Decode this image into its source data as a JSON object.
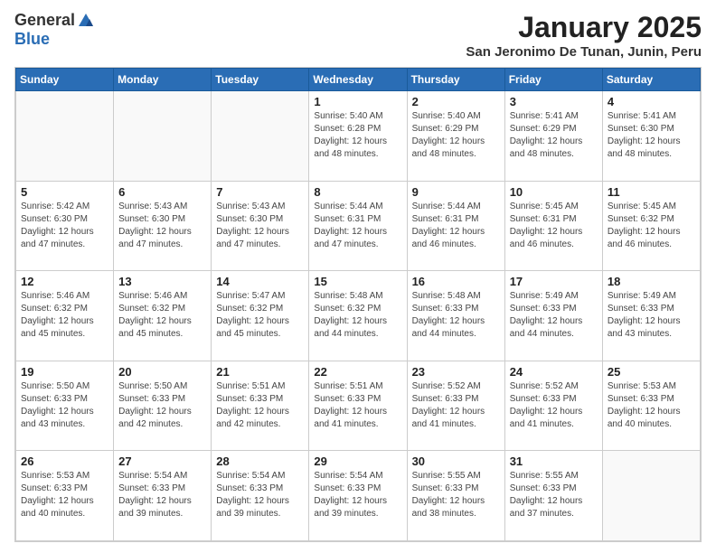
{
  "header": {
    "logo": {
      "general": "General",
      "blue": "Blue"
    },
    "title": "January 2025",
    "subtitle": "San Jeronimo De Tunan, Junin, Peru"
  },
  "calendar": {
    "days_of_week": [
      "Sunday",
      "Monday",
      "Tuesday",
      "Wednesday",
      "Thursday",
      "Friday",
      "Saturday"
    ],
    "weeks": [
      [
        {
          "day": "",
          "info": ""
        },
        {
          "day": "",
          "info": ""
        },
        {
          "day": "",
          "info": ""
        },
        {
          "day": "1",
          "info": "Sunrise: 5:40 AM\nSunset: 6:28 PM\nDaylight: 12 hours\nand 48 minutes."
        },
        {
          "day": "2",
          "info": "Sunrise: 5:40 AM\nSunset: 6:29 PM\nDaylight: 12 hours\nand 48 minutes."
        },
        {
          "day": "3",
          "info": "Sunrise: 5:41 AM\nSunset: 6:29 PM\nDaylight: 12 hours\nand 48 minutes."
        },
        {
          "day": "4",
          "info": "Sunrise: 5:41 AM\nSunset: 6:30 PM\nDaylight: 12 hours\nand 48 minutes."
        }
      ],
      [
        {
          "day": "5",
          "info": "Sunrise: 5:42 AM\nSunset: 6:30 PM\nDaylight: 12 hours\nand 47 minutes."
        },
        {
          "day": "6",
          "info": "Sunrise: 5:43 AM\nSunset: 6:30 PM\nDaylight: 12 hours\nand 47 minutes."
        },
        {
          "day": "7",
          "info": "Sunrise: 5:43 AM\nSunset: 6:30 PM\nDaylight: 12 hours\nand 47 minutes."
        },
        {
          "day": "8",
          "info": "Sunrise: 5:44 AM\nSunset: 6:31 PM\nDaylight: 12 hours\nand 47 minutes."
        },
        {
          "day": "9",
          "info": "Sunrise: 5:44 AM\nSunset: 6:31 PM\nDaylight: 12 hours\nand 46 minutes."
        },
        {
          "day": "10",
          "info": "Sunrise: 5:45 AM\nSunset: 6:31 PM\nDaylight: 12 hours\nand 46 minutes."
        },
        {
          "day": "11",
          "info": "Sunrise: 5:45 AM\nSunset: 6:32 PM\nDaylight: 12 hours\nand 46 minutes."
        }
      ],
      [
        {
          "day": "12",
          "info": "Sunrise: 5:46 AM\nSunset: 6:32 PM\nDaylight: 12 hours\nand 45 minutes."
        },
        {
          "day": "13",
          "info": "Sunrise: 5:46 AM\nSunset: 6:32 PM\nDaylight: 12 hours\nand 45 minutes."
        },
        {
          "day": "14",
          "info": "Sunrise: 5:47 AM\nSunset: 6:32 PM\nDaylight: 12 hours\nand 45 minutes."
        },
        {
          "day": "15",
          "info": "Sunrise: 5:48 AM\nSunset: 6:32 PM\nDaylight: 12 hours\nand 44 minutes."
        },
        {
          "day": "16",
          "info": "Sunrise: 5:48 AM\nSunset: 6:33 PM\nDaylight: 12 hours\nand 44 minutes."
        },
        {
          "day": "17",
          "info": "Sunrise: 5:49 AM\nSunset: 6:33 PM\nDaylight: 12 hours\nand 44 minutes."
        },
        {
          "day": "18",
          "info": "Sunrise: 5:49 AM\nSunset: 6:33 PM\nDaylight: 12 hours\nand 43 minutes."
        }
      ],
      [
        {
          "day": "19",
          "info": "Sunrise: 5:50 AM\nSunset: 6:33 PM\nDaylight: 12 hours\nand 43 minutes."
        },
        {
          "day": "20",
          "info": "Sunrise: 5:50 AM\nSunset: 6:33 PM\nDaylight: 12 hours\nand 42 minutes."
        },
        {
          "day": "21",
          "info": "Sunrise: 5:51 AM\nSunset: 6:33 PM\nDaylight: 12 hours\nand 42 minutes."
        },
        {
          "day": "22",
          "info": "Sunrise: 5:51 AM\nSunset: 6:33 PM\nDaylight: 12 hours\nand 41 minutes."
        },
        {
          "day": "23",
          "info": "Sunrise: 5:52 AM\nSunset: 6:33 PM\nDaylight: 12 hours\nand 41 minutes."
        },
        {
          "day": "24",
          "info": "Sunrise: 5:52 AM\nSunset: 6:33 PM\nDaylight: 12 hours\nand 41 minutes."
        },
        {
          "day": "25",
          "info": "Sunrise: 5:53 AM\nSunset: 6:33 PM\nDaylight: 12 hours\nand 40 minutes."
        }
      ],
      [
        {
          "day": "26",
          "info": "Sunrise: 5:53 AM\nSunset: 6:33 PM\nDaylight: 12 hours\nand 40 minutes."
        },
        {
          "day": "27",
          "info": "Sunrise: 5:54 AM\nSunset: 6:33 PM\nDaylight: 12 hours\nand 39 minutes."
        },
        {
          "day": "28",
          "info": "Sunrise: 5:54 AM\nSunset: 6:33 PM\nDaylight: 12 hours\nand 39 minutes."
        },
        {
          "day": "29",
          "info": "Sunrise: 5:54 AM\nSunset: 6:33 PM\nDaylight: 12 hours\nand 39 minutes."
        },
        {
          "day": "30",
          "info": "Sunrise: 5:55 AM\nSunset: 6:33 PM\nDaylight: 12 hours\nand 38 minutes."
        },
        {
          "day": "31",
          "info": "Sunrise: 5:55 AM\nSunset: 6:33 PM\nDaylight: 12 hours\nand 37 minutes."
        },
        {
          "day": "",
          "info": ""
        }
      ]
    ]
  }
}
